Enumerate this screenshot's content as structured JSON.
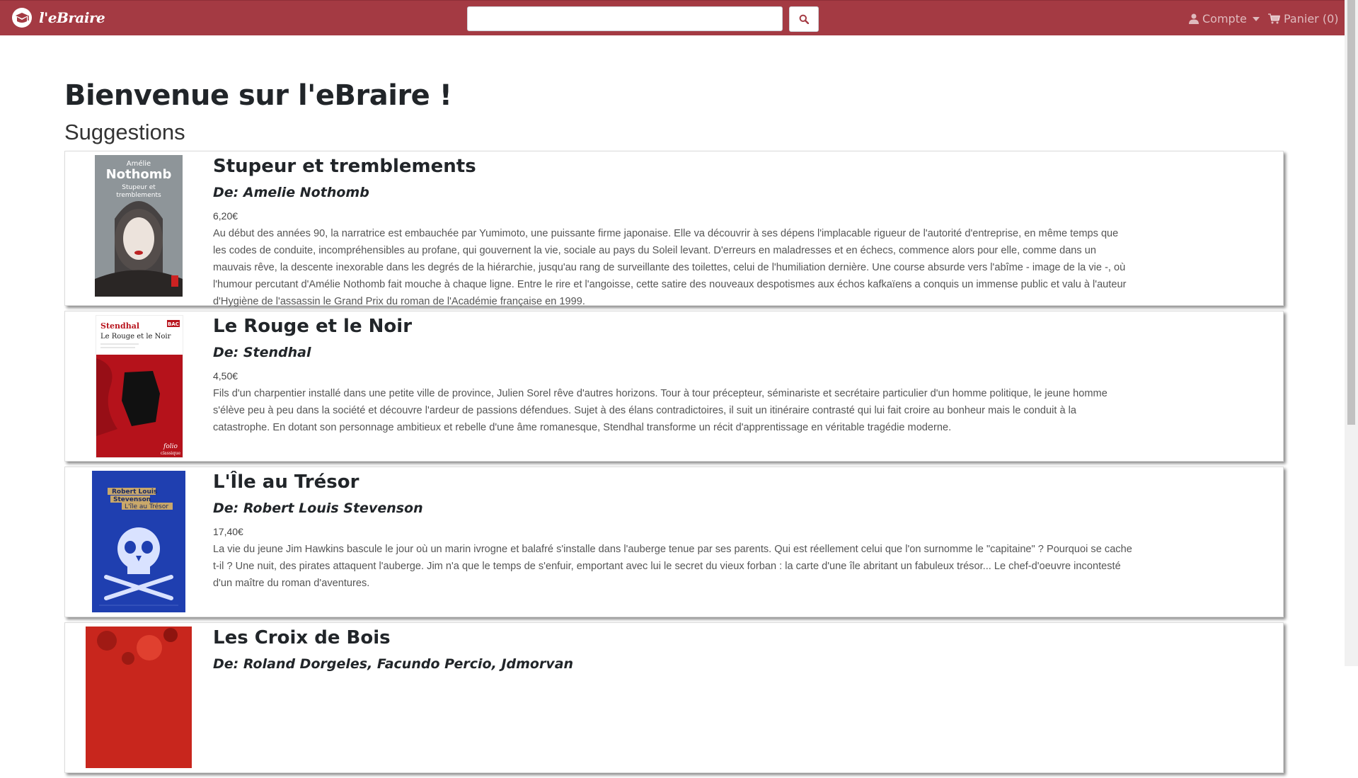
{
  "navbar": {
    "brand": "l'eBraire",
    "search": {
      "value": "",
      "placeholder": ""
    },
    "account_label": "Compte",
    "cart_label": "Panier (0)",
    "bg_color": "#a43a43"
  },
  "main": {
    "title": "Bienvenue sur l'eBraire !",
    "section_title": "Suggestions",
    "books": [
      {
        "title": "Stupeur et tremblements",
        "author": "De: Amelie Nothomb",
        "price": "6,20€",
        "description": "Au début des années 90, la narratrice est embauchée par Yumimoto, une puissante firme japonaise. Elle va découvrir à ses dépens l'implacable rigueur de l'autorité d'entreprise, en même temps que les codes de conduite, incompréhensibles au profane, qui gouvernent la vie, sociale au pays du Soleil levant. D'erreurs en maladresses et en échecs, commence alors pour elle, comme dans un mauvais rêve, la descente inexorable dans les degrés de la hiérarchie, jusqu'au rang de surveillante des toilettes, celui de l'humiliation dernière. Une course absurde vers l'abîme - image de la vie -, où l'humour percutant d'Amélie Nothomb fait mouche à chaque ligne. Entre le rire et l'angoisse, cette satire des nouveaux despotismes aux échos kafkaïens a conquis un immense public et valu à l'auteur d'Hygiène de l'assassin le Grand Prix du roman de l'Académie française en 1999.",
        "cover": {
          "author_text": "Amélie",
          "name_text": "Nothomb",
          "title_text": "Stupeur et tremblements"
        }
      },
      {
        "title": "Le Rouge et le Noir",
        "author": "De: Stendhal",
        "price": "4,50€",
        "description": "Fils d'un charpentier installé dans une petite ville de province, Julien Sorel rêve d'autres horizons. Tour à tour précepteur, séminariste et secrétaire particulier d'un homme politique, le jeune homme s'élève peu à peu dans la société et découvre l'ardeur de passions défendues. Sujet à des élans contradictoires, il suit un itinéraire contrasté qui lui fait croire au bonheur mais le conduit à la catastrophe. En dotant son personnage ambitieux et rebelle d'une âme romanesque, Stendhal transforme un récit d'apprentissage en véritable tragédie moderne.",
        "cover": {
          "author_text": "Stendhal",
          "title_text": "Le Rouge et le Noir",
          "badge_text": "BAC",
          "publisher_text": "folio classique"
        }
      },
      {
        "title": "L'Île au Trésor",
        "author": "De: Robert Louis Stevenson",
        "price": "17,40€",
        "description": "La vie du jeune Jim Hawkins bascule le jour où un marin ivrogne et balafré s'installe dans l'auberge tenue par ses parents. Qui est réellement celui que l'on surnomme le \"capitaine\" ? Pourquoi se cache t-il ? Une nuit, des pirates attaquent l'auberge. Jim n'a que le temps de s'enfuir, emportant avec lui le secret du vieux forban : la carte d'une île abritant un fabuleux trésor... Le chef-d'oeuvre incontesté d'un maître du roman d'aventures.",
        "cover": {
          "author_text": "Robert Louis Stevenson",
          "title_text": "L'île au Trésor"
        }
      },
      {
        "title": "Les Croix de Bois",
        "author": "De: Roland Dorgeles, Facundo Percio, Jdmorvan",
        "price": "",
        "description": "",
        "cover": {}
      }
    ]
  }
}
